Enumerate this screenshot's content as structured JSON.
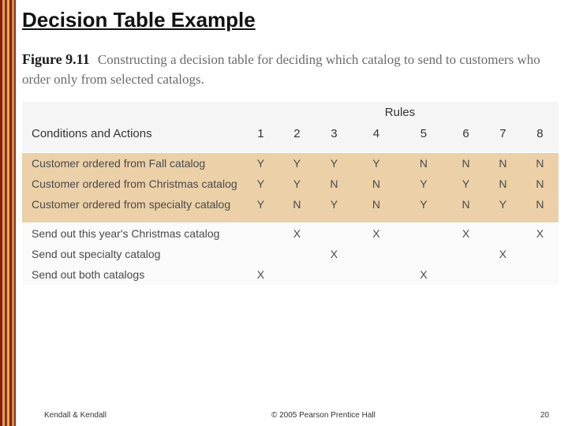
{
  "slide_title": "Decision Table Example",
  "figure": {
    "label": "Figure 9.11",
    "caption": "Constructing a decision table for deciding which catalog to send to customers who order only from selected catalogs."
  },
  "table": {
    "header_left": "Conditions and Actions",
    "rules_label": "Rules",
    "rule_numbers": [
      "1",
      "2",
      "3",
      "4",
      "5",
      "6",
      "7",
      "8"
    ],
    "conditions": [
      {
        "label": "Customer ordered from Fall catalog",
        "cells": [
          "Y",
          "Y",
          "Y",
          "Y",
          "N",
          "N",
          "N",
          "N"
        ]
      },
      {
        "label": "Customer ordered from Christmas catalog",
        "cells": [
          "Y",
          "Y",
          "N",
          "N",
          "Y",
          "Y",
          "N",
          "N"
        ]
      },
      {
        "label": "Customer ordered from specialty catalog",
        "cells": [
          "Y",
          "N",
          "Y",
          "N",
          "Y",
          "N",
          "Y",
          "N"
        ]
      }
    ],
    "actions": [
      {
        "label": "Send out this year's Christmas catalog",
        "cells": [
          "",
          "X",
          "",
          "X",
          "",
          "X",
          "",
          "X"
        ]
      },
      {
        "label": "Send out specialty catalog",
        "cells": [
          "",
          "",
          "X",
          "",
          "",
          "",
          "X",
          ""
        ]
      },
      {
        "label": "Send out both catalogs",
        "cells": [
          "X",
          "",
          "",
          "",
          "X",
          "",
          "",
          ""
        ]
      }
    ]
  },
  "footer": {
    "left": "Kendall & Kendall",
    "center": "© 2005 Pearson Prentice Hall",
    "page": "20"
  }
}
